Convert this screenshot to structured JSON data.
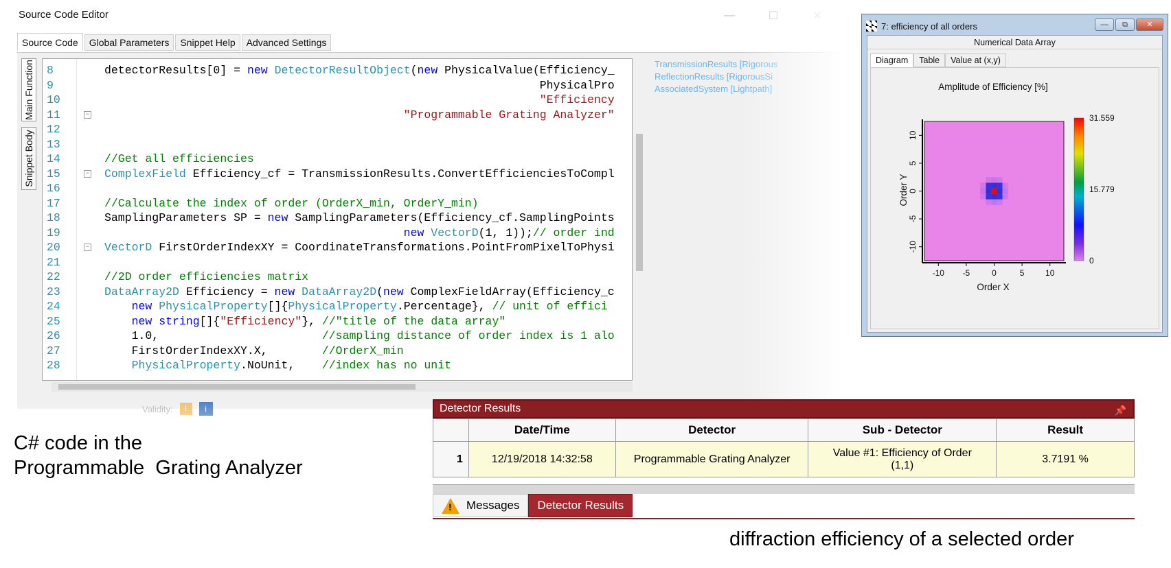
{
  "editor": {
    "title": "Source Code Editor",
    "tabs": [
      "Source Code",
      "Global Parameters",
      "Snippet Help",
      "Advanced Settings"
    ],
    "vertical_tabs": [
      "Main Function",
      "Snippet Body"
    ],
    "side_items": [
      "TransmissionResults [Rigorous",
      "ReflectionResults [RigorousSi",
      "AssociatedSystem [Lightpath]"
    ],
    "validity_label": "Validity:",
    "lines": [
      {
        "n": "8",
        "text": "detectorResults[0] = new DetectorResultObject(new PhysicalValue(Efficiency_"
      },
      {
        "n": "9",
        "text": "                                                                PhysicalPro"
      },
      {
        "n": "10",
        "text": "                                                                \"Efficiency"
      },
      {
        "n": "11",
        "text": "                                            \"Programmable Grating Analyzer\""
      },
      {
        "n": "12",
        "text": ""
      },
      {
        "n": "13",
        "text": ""
      },
      {
        "n": "14",
        "text": "//Get all efficiencies"
      },
      {
        "n": "15",
        "text": "ComplexField Efficiency_cf = TransmissionResults.ConvertEfficienciesToCompl"
      },
      {
        "n": "16",
        "text": ""
      },
      {
        "n": "17",
        "text": "//Calculate the index of order (OrderX_min, OrderY_min)"
      },
      {
        "n": "18",
        "text": "SamplingParameters SP = new SamplingParameters(Efficiency_cf.SamplingPoints"
      },
      {
        "n": "19",
        "text": "                                            new VectorD(1, 1));// order ind"
      },
      {
        "n": "20",
        "text": "VectorD FirstOrderIndexXY = CoordinateTransformations.PointFromPixelToPhysi"
      },
      {
        "n": "21",
        "text": ""
      },
      {
        "n": "22",
        "text": "//2D order efficiencies matrix"
      },
      {
        "n": "23",
        "text": "DataArray2D Efficiency = new DataArray2D(new ComplexFieldArray(Efficiency_c"
      },
      {
        "n": "24",
        "text": "    new PhysicalProperty[]{PhysicalProperty.Percentage}, // unit of effici"
      },
      {
        "n": "25",
        "text": "    new string[]{\"Efficiency\"}, //\"title of the data array\""
      },
      {
        "n": "26",
        "text": "    1.0,                        //sampling distance of order index is 1 alo"
      },
      {
        "n": "27",
        "text": "    FirstOrderIndexXY.X,        //OrderX_min"
      },
      {
        "n": "28",
        "text": "    PhysicalProperty.NoUnit,    //index has no unit"
      }
    ]
  },
  "captions": {
    "left": "C# code in the\nProgrammable  Grating Analyzer",
    "right": "diffraction efficiency of a selected order"
  },
  "plot_window": {
    "title": "7: efficiency of all orders",
    "subtitle": "Numerical Data Array",
    "tabs": [
      "Diagram",
      "Table",
      "Value at (x,y)"
    ]
  },
  "chart_data": {
    "type": "heatmap",
    "title": "Amplitude of Efficiency  [%]",
    "xlabel": "Order X",
    "ylabel": "Order Y",
    "x_ticks": [
      "-10",
      "-5",
      "0",
      "5",
      "10"
    ],
    "y_ticks": [
      "10",
      "5",
      "0",
      "-5",
      "-10"
    ],
    "xlim": [
      -12.5,
      12.5
    ],
    "ylim": [
      -12.5,
      12.5
    ],
    "colorbar_ticks": [
      "31.559",
      "15.779",
      "0"
    ],
    "colorbar_range": [
      0,
      31.559
    ],
    "background_color": "#e985e9",
    "cells": [
      {
        "x": 0,
        "y": 0,
        "value": 31.559,
        "color": "#ff0000"
      },
      {
        "x": -1,
        "y": 0,
        "value": 3.7,
        "color": "#2e33d8"
      },
      {
        "x": 1,
        "y": 0,
        "value": 3.7,
        "color": "#2e33d8"
      },
      {
        "x": 0,
        "y": 1,
        "value": 3.7,
        "color": "#2e33d8"
      },
      {
        "x": 0,
        "y": -1,
        "value": 3.7,
        "color": "#2e33d8"
      },
      {
        "x": -1,
        "y": 1,
        "value": 3.7191,
        "color": "#3b2fe0"
      },
      {
        "x": 1,
        "y": 1,
        "value": 3.7191,
        "color": "#3b2fe0"
      },
      {
        "x": -1,
        "y": -1,
        "value": 3.7191,
        "color": "#3b2fe0"
      },
      {
        "x": 1,
        "y": -1,
        "value": 3.7191,
        "color": "#3b2fe0"
      },
      {
        "x": -2,
        "y": 0,
        "value": 0.8,
        "color": "#c673ee"
      },
      {
        "x": 2,
        "y": 0,
        "value": 0.8,
        "color": "#c673ee"
      },
      {
        "x": 0,
        "y": 2,
        "value": 0.8,
        "color": "#c673ee"
      },
      {
        "x": 0,
        "y": -2,
        "value": 0.8,
        "color": "#c673ee"
      },
      {
        "x": -1,
        "y": 2,
        "value": 0.8,
        "color": "#cf78ec"
      },
      {
        "x": 1,
        "y": 2,
        "value": 0.8,
        "color": "#cf78ec"
      },
      {
        "x": -1,
        "y": -2,
        "value": 0.8,
        "color": "#cf78ec"
      },
      {
        "x": 1,
        "y": -2,
        "value": 0.8,
        "color": "#cf78ec"
      },
      {
        "x": -2,
        "y": 1,
        "value": 0.8,
        "color": "#cf78ec"
      },
      {
        "x": 2,
        "y": 1,
        "value": 0.8,
        "color": "#cf78ec"
      },
      {
        "x": -2,
        "y": -1,
        "value": 0.8,
        "color": "#cf78ec"
      },
      {
        "x": 2,
        "y": -1,
        "value": 0.8,
        "color": "#cf78ec"
      }
    ]
  },
  "detector_results": {
    "header": "Detector Results",
    "columns": [
      "",
      "Date/Time",
      "Detector",
      "Sub - Detector",
      "Result"
    ],
    "rows": [
      [
        "1",
        "12/19/2018 14:32:58",
        "Programmable Grating Analyzer",
        "Value #1: Efficiency of Order (1,1)",
        "3.7191 %"
      ]
    ],
    "tabs": [
      "Messages",
      "Detector Results"
    ]
  },
  "colors": {
    "accent_red": "#8b1e22",
    "detector_tab_active": "#a3272d",
    "row_highlight": "#fbfbd7"
  }
}
